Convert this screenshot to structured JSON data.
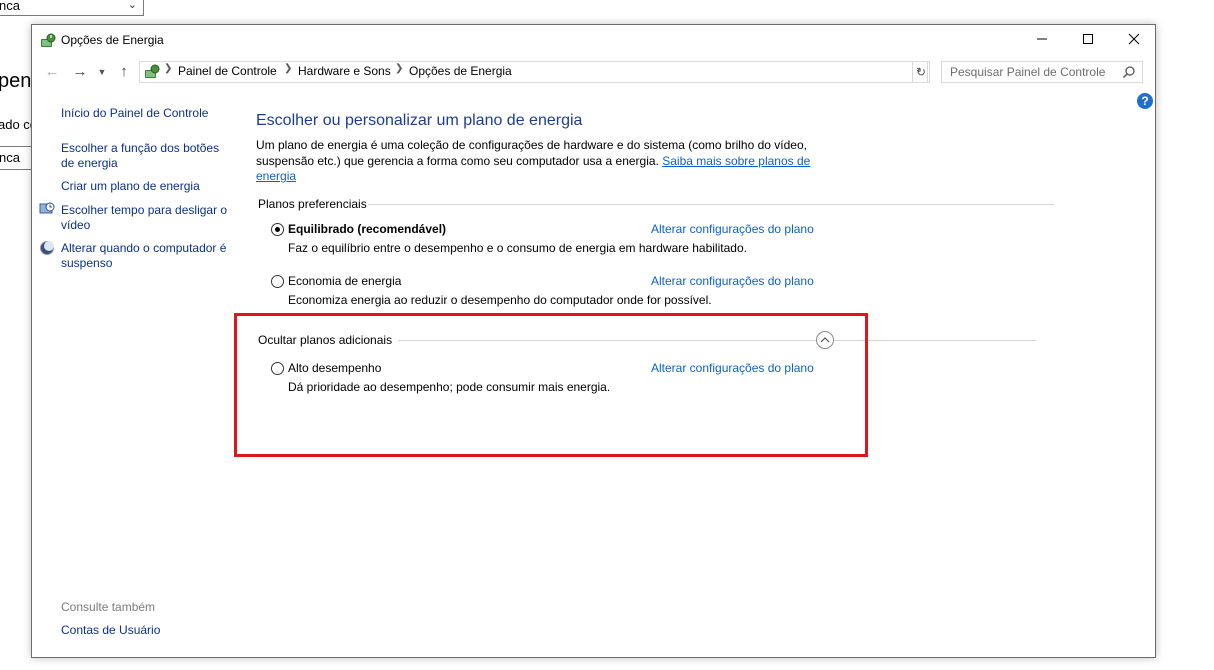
{
  "background": {
    "dropdown_text": "nca",
    "text1": "pen",
    "text2": "ado co",
    "field_text": "nca"
  },
  "window": {
    "title": "Opções de Energia",
    "icon": "power-options-icon"
  },
  "address": {
    "breadcrumbs": [
      "Painel de Controle",
      "Hardware e Sons",
      "Opções de Energia"
    ],
    "search_placeholder": "Pesquisar Painel de Controle"
  },
  "sidebar": {
    "home": "Início do Painel de Controle",
    "items": [
      "Escolher a função dos botões de energia",
      "Criar um plano de energia",
      "Escolher tempo para desligar o vídeo",
      "Alterar quando o computador é suspenso"
    ],
    "see_also": "Consulte também",
    "user_accounts": "Contas de Usuário"
  },
  "main": {
    "heading": "Escolher ou personalizar um plano de energia",
    "description": "Um plano de energia é uma coleção de configurações de hardware e do sistema (como brilho do vídeo, suspensão etc.) que gerencia a forma como seu computador usa a energia.",
    "learn_more": "Saiba mais sobre planos de energia",
    "preferred_label": "Planos preferenciais",
    "additional_label": "Ocultar planos adicionais",
    "change_link": "Alterar configurações do plano",
    "plans": [
      {
        "name": "Equilibrado (recomendável)",
        "desc": "Faz o equilíbrio entre o desempenho e o consumo de energia em hardware habilitado.",
        "selected": true
      },
      {
        "name": "Economia de energia",
        "desc": "Economiza energia ao reduzir o desempenho do computador onde for possível.",
        "selected": false
      },
      {
        "name": "Alto desempenho",
        "desc": "Dá prioridade ao desempenho; pode consumir mais energia.",
        "selected": false
      }
    ]
  },
  "colors": {
    "highlight": "#e0151d",
    "link": "#0b61c7",
    "heading": "#1b3d92"
  }
}
